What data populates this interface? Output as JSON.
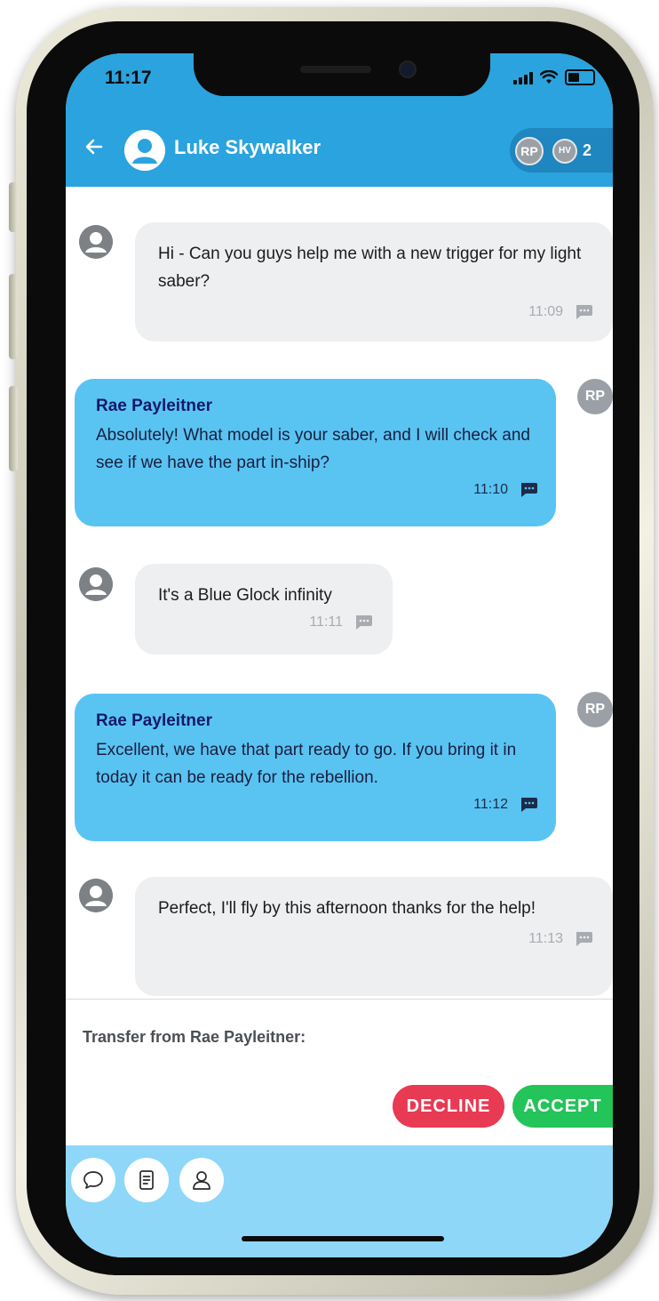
{
  "status_bar": {
    "time": "11:17"
  },
  "header": {
    "contact_name": "Luke Skywalker",
    "agents": [
      "RP",
      "HV"
    ],
    "agent_count": "2"
  },
  "messages": [
    {
      "direction": "incoming",
      "text": "Hi - Can you guys help me with a new trigger for my light saber?",
      "time": "11:09"
    },
    {
      "direction": "outgoing",
      "sender": "Rae Payleitner",
      "initials": "RP",
      "text": "Absolutely! What model is your saber, and I will check and see if we have the part in-ship?",
      "time": "11:10"
    },
    {
      "direction": "incoming",
      "text": "It's a Blue Glock infinity",
      "time": "11:11"
    },
    {
      "direction": "outgoing",
      "sender": "Rae Payleitner",
      "initials": "RP",
      "text": "Excellent, we have that part ready to go. If you bring it in today it can be ready for the rebellion.",
      "time": "11:12"
    },
    {
      "direction": "incoming",
      "text": "Perfect, I'll fly by this afternoon thanks for the help!",
      "time": "11:13"
    }
  ],
  "transfer": {
    "label": "Transfer from Rae Payleitner:",
    "decline_label": "DECLINE",
    "accept_label": "ACCEPT"
  },
  "bottom_bar": {
    "icons": [
      "chat-icon",
      "notes-icon",
      "profile-icon"
    ]
  },
  "colors": {
    "header": "#2aa3de",
    "outgoing_bubble": "#59c4f2",
    "incoming_bubble": "#eeeff1",
    "decline": "#e83a52",
    "accept": "#23c45a",
    "bottom_bar": "#8fd7f8"
  }
}
